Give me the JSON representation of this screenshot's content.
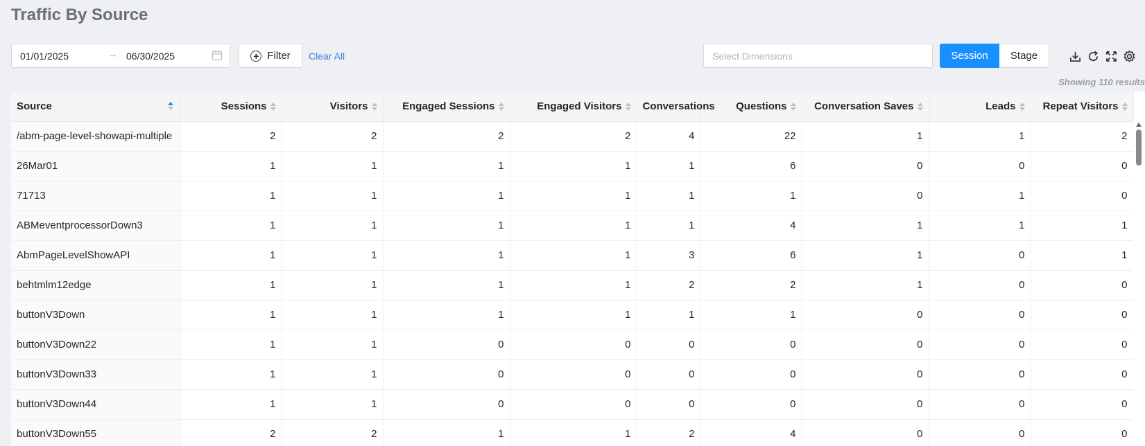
{
  "title": "Traffic By Source",
  "date_range": {
    "start": "01/01/2025",
    "end": "06/30/2025",
    "arrow": "→"
  },
  "filter": {
    "label": "Filter",
    "clear_label": "Clear All"
  },
  "dimensions": {
    "placeholder": "Select Dimensions"
  },
  "segment": {
    "session_label": "Session",
    "stage_label": "Stage",
    "active": "Session"
  },
  "toolbar_icons": [
    "download-icon",
    "refresh-icon",
    "fullscreen-icon",
    "settings-icon"
  ],
  "results_text": "Showing 110 results",
  "colors": {
    "accent": "#1890ff",
    "link": "#3d7bd9",
    "title": "#6b6f76"
  },
  "table": {
    "columns": [
      "Source",
      "Sessions",
      "Visitors",
      "Engaged Sessions",
      "Engaged Visitors",
      "Conversations",
      "Questions",
      "Conversation Saves",
      "Leads",
      "Repeat Visitors"
    ],
    "rows": [
      [
        "/abm-page-level-showapi-multiple",
        "2",
        "2",
        "2",
        "2",
        "4",
        "22",
        "1",
        "1",
        "2"
      ],
      [
        "26Mar01",
        "1",
        "1",
        "1",
        "1",
        "1",
        "6",
        "0",
        "0",
        "0"
      ],
      [
        "71713",
        "1",
        "1",
        "1",
        "1",
        "1",
        "1",
        "0",
        "1",
        "0"
      ],
      [
        "ABMeventprocessorDown3",
        "1",
        "1",
        "1",
        "1",
        "1",
        "4",
        "1",
        "1",
        "1"
      ],
      [
        "AbmPageLevelShowAPI",
        "1",
        "1",
        "1",
        "1",
        "3",
        "6",
        "1",
        "0",
        "1"
      ],
      [
        "behtmlm12edge",
        "1",
        "1",
        "1",
        "1",
        "2",
        "2",
        "1",
        "0",
        "0"
      ],
      [
        "buttonV3Down",
        "1",
        "1",
        "1",
        "1",
        "1",
        "1",
        "0",
        "0",
        "0"
      ],
      [
        "buttonV3Down22",
        "1",
        "1",
        "0",
        "0",
        "0",
        "0",
        "0",
        "0",
        "0"
      ],
      [
        "buttonV3Down33",
        "1",
        "1",
        "0",
        "0",
        "0",
        "0",
        "0",
        "0",
        "0"
      ],
      [
        "buttonV3Down44",
        "1",
        "1",
        "0",
        "0",
        "0",
        "0",
        "0",
        "0",
        "0"
      ],
      [
        "buttonV3Down55",
        "2",
        "2",
        "1",
        "1",
        "2",
        "4",
        "0",
        "0",
        "0"
      ]
    ]
  }
}
